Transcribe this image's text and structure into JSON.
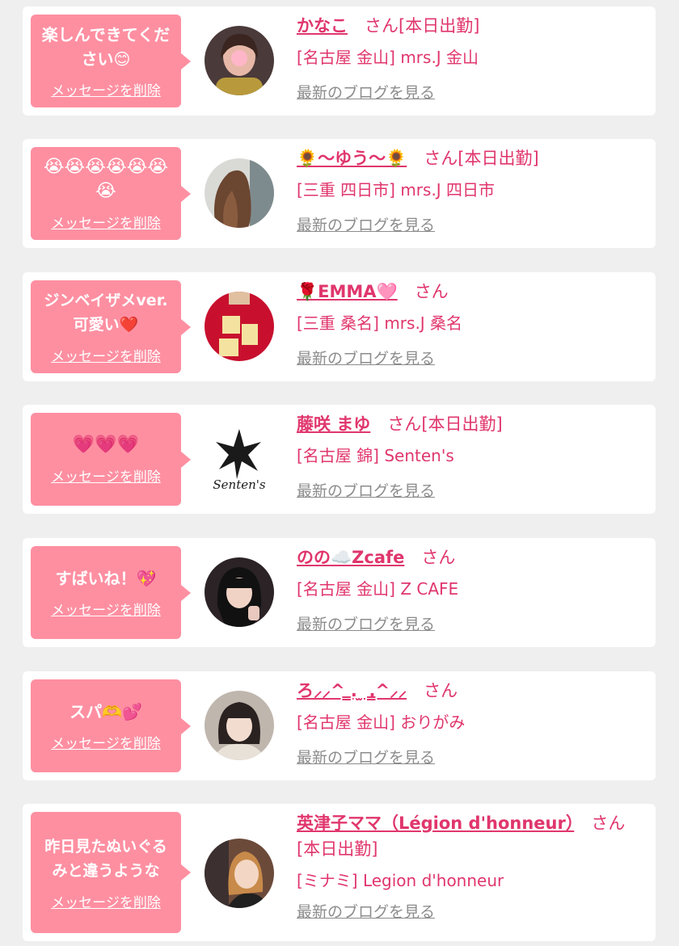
{
  "ui": {
    "delete_label": "メッセージを削除",
    "blog_label": "最新のブログを見る",
    "san_label": "さん"
  },
  "colors": {
    "bubble": "#fe8fa1",
    "accent": "#e0366d",
    "link_gray": "#8c8c8c",
    "background": "#efefef",
    "card": "#ffffff"
  },
  "entries": [
    {
      "message": "楽しんできてください😊",
      "name": "かなこ",
      "status": "[本日出勤]",
      "shop": "[名古屋 金山] mrs.J 金山",
      "avatar": "portrait-photo"
    },
    {
      "message": "😭😭😭😭😭😭😭",
      "name": "🌻～ゆう～🌻",
      "status": "[本日出勤]",
      "shop": "[三重 四日市] mrs.J 四日市",
      "avatar": "portrait-photo"
    },
    {
      "message": "ジンベイザメver.可愛い❤️",
      "name": "🌹EMMA🩷",
      "status": "",
      "shop": "[三重 桑名] mrs.J 桑名",
      "avatar": "red-shirt-photo"
    },
    {
      "message": "💗💗💗",
      "name": "藤咲 まゆ",
      "status": "[本日出勤]",
      "shop": "[名古屋 錦] Senten's",
      "avatar": "star-logo",
      "logo_text": "Senten's"
    },
    {
      "message": "すばいね！💖",
      "name": "のの☁️Zcafe",
      "status": "",
      "shop": "[名古屋 金山] Z CAFE",
      "avatar": "portrait-photo"
    },
    {
      "message": "スパ🫶💕",
      "name": "ろ⸝⸝^ ̳. ̫ .̳^⸝⸝",
      "status": "",
      "shop": "[名古屋 金山] おりがみ",
      "avatar": "portrait-photo"
    },
    {
      "message": "昨日見たぬいぐるみと違うような",
      "name": "英津子ママ（Légion d'honneur）",
      "status": "[本日出勤]",
      "shop": "[ミナミ] Legion d'honneur",
      "avatar": "portrait-photo"
    }
  ]
}
